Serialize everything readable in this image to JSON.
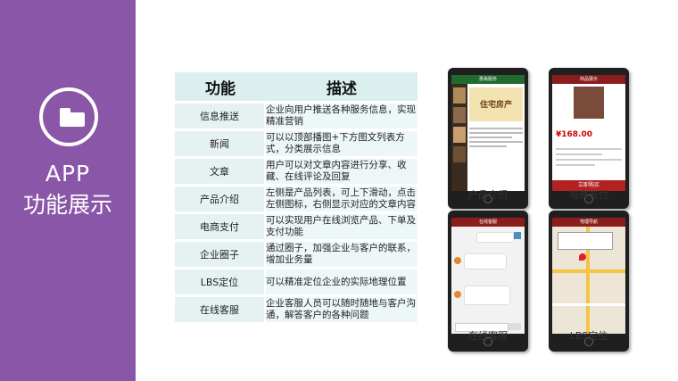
{
  "sidebar": {
    "title_en": "APP",
    "title_zh": "功能展示",
    "bg_color": "#8a56a8",
    "icon": "folder-icon"
  },
  "table": {
    "header": {
      "name": "功能",
      "desc": "描述"
    },
    "rows": [
      {
        "name": "信息推送",
        "desc": "企业向用户推送各种服务信息，实现精准营销"
      },
      {
        "name": "新闻",
        "desc": "可以以顶部播图+下方图文列表方式，分类展示信息"
      },
      {
        "name": "文章",
        "desc": "用户可以对文章内容进行分享、收藏、在线评论及回复"
      },
      {
        "name": "产品介绍",
        "desc": "左侧是产品列表，可上下滑动，点击左侧图标，右侧显示对应的文章内容"
      },
      {
        "name": "电商支付",
        "desc": "可以实现用户在线浏览产品、下单及支付功能"
      },
      {
        "name": "企业圈子",
        "desc": "通过圈子，加强企业与客户的联系，增加业务量"
      },
      {
        "name": "LBS定位",
        "desc": "可以精准定位企业的实际地理位置"
      },
      {
        "name": "在线客服",
        "desc": "企业客服人员可以随时随地与客户沟通，解答客户的各种问题"
      }
    ]
  },
  "phones": {
    "p1": {
      "caption": "产品介绍",
      "header": "惠易服务",
      "sign": "住宅房产"
    },
    "p2": {
      "caption": "电商支付",
      "header": "商品展示",
      "price": "¥168.00",
      "buy": "立即购买"
    },
    "p3": {
      "caption": "在线客服",
      "header": "在线客服"
    },
    "p4": {
      "caption": "LBS定位",
      "header": "地理导航"
    }
  }
}
